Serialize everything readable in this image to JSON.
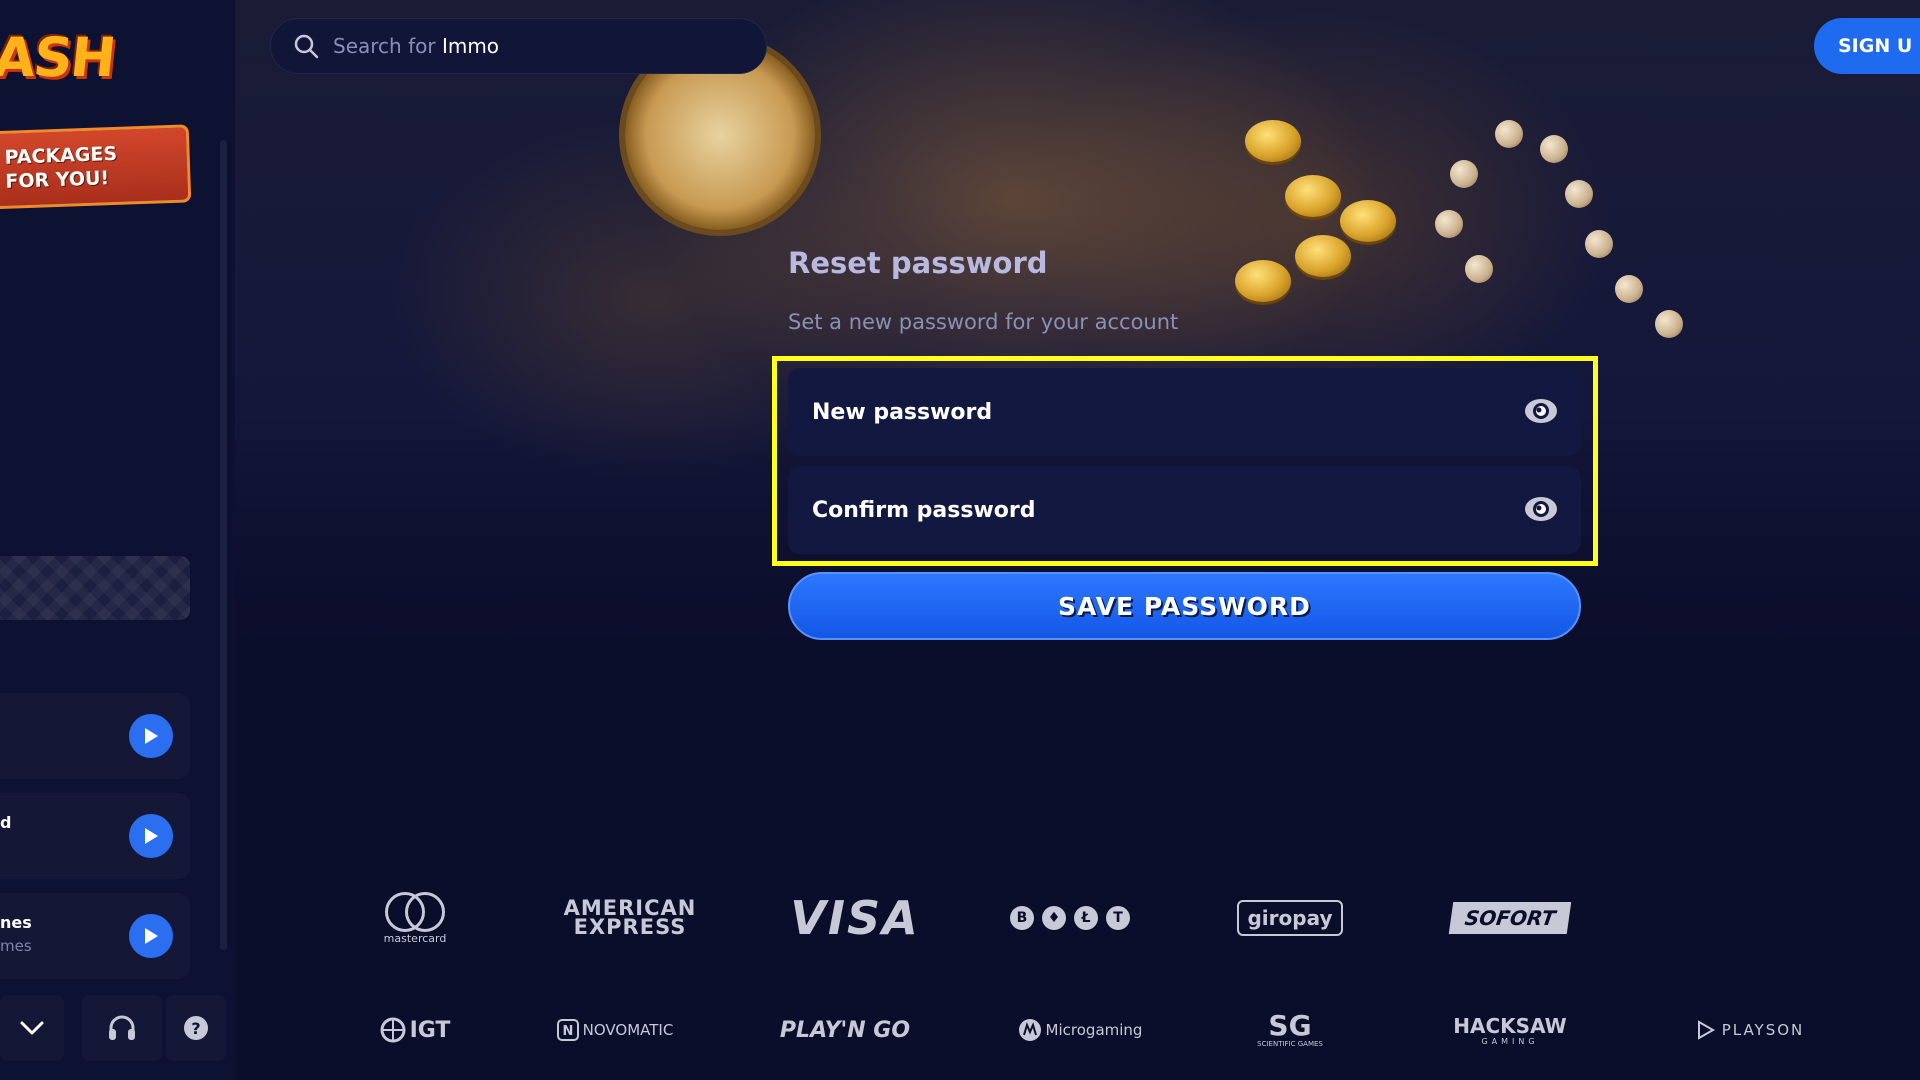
{
  "brand": {
    "logo_text": "ASH",
    "promo_text": "PACKAGES\nFOR YOU!"
  },
  "search": {
    "prefix": "Search for",
    "term": "Immo"
  },
  "header": {
    "signup_label": "SIGN U"
  },
  "sidebar": {
    "games": [
      {
        "name": "",
        "sub": ""
      },
      {
        "name": "d",
        "sub": ""
      },
      {
        "name": "nes",
        "sub": "mes"
      }
    ]
  },
  "form": {
    "title": "Reset password",
    "subtitle": "Set a new password for your account",
    "new_password_placeholder": "New password",
    "confirm_password_placeholder": "Confirm password",
    "save_label": "SAVE PASSWORD"
  },
  "payments": {
    "mastercard": "mastercard",
    "amex": "AMERICAN\nEXPRESS",
    "visa": "VISA",
    "crypto": [
      "B",
      "♦",
      "Ł",
      "T"
    ],
    "giropay": "giropay",
    "sofort": "SOFORT"
  },
  "providers": {
    "igt": "IGT",
    "novomatic": "NOVOMATIC",
    "playngo": "PLAY'N GO",
    "microgaming": "Microgaming",
    "sg": "SG",
    "sg_caption": "SCIENTIFIC GAMES",
    "hacksaw": "HACKSAW",
    "hacksaw_caption": "GAMING",
    "playson": "PLAYSON"
  },
  "colors": {
    "accent": "#1f6bf0",
    "highlight": "#ffff19",
    "background": "#0b0e2b"
  },
  "icons": [
    "search-icon",
    "eye-icon",
    "play-icon",
    "chevron-down-icon",
    "headset-icon",
    "help-icon"
  ]
}
